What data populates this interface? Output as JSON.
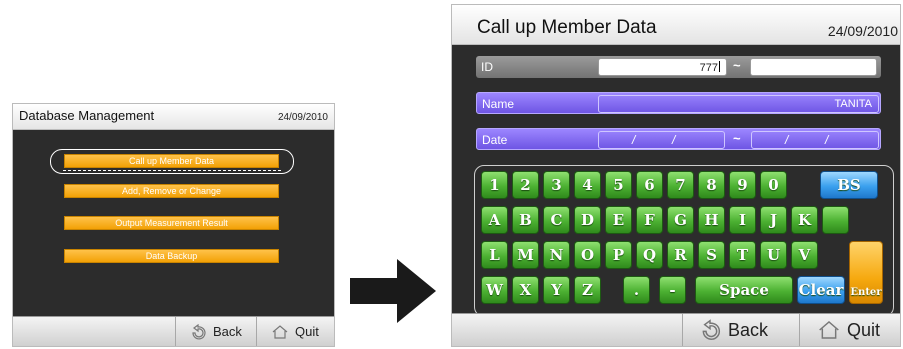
{
  "left_screen": {
    "title": "Database Management",
    "date": "24/09/2010",
    "menu": [
      {
        "label": "Call up Member Data"
      },
      {
        "label": "Add, Remove or Change"
      },
      {
        "label": "Output Measurement Result"
      },
      {
        "label": "Data Backup"
      }
    ],
    "bottom": {
      "back_label": "Back",
      "quit_label": "Quit"
    }
  },
  "right_screen": {
    "title": "Call up Member Data",
    "date": "24/09/2010",
    "fields": {
      "id": {
        "label": "ID",
        "from": "777",
        "range_sep": "~",
        "to": ""
      },
      "name": {
        "label": "Name",
        "value": "TANITA"
      },
      "date": {
        "label": "Date",
        "sep": "/",
        "range_sep": "~"
      }
    },
    "keyboard": {
      "rows": [
        [
          "1",
          "2",
          "3",
          "4",
          "5",
          "6",
          "7",
          "8",
          "9",
          "0",
          "BS"
        ],
        [
          "A",
          "B",
          "C",
          "D",
          "E",
          "F",
          "G",
          "H",
          "I",
          "J",
          "K",
          ""
        ],
        [
          "L",
          "M",
          "N",
          "O",
          "P",
          "Q",
          "R",
          "S",
          "T",
          "U",
          "V"
        ],
        [
          "W",
          "X",
          "Y",
          "Z",
          ".",
          "-",
          "Space",
          "Clear",
          "Enter"
        ]
      ]
    },
    "bottom": {
      "back_label": "Back",
      "quit_label": "Quit"
    }
  },
  "colors": {
    "menu_button": "#f3a106",
    "field_purple": "#7d66f0",
    "key_green": "#4cb132",
    "key_blue": "#3aa0ee",
    "key_orange": "#f6a90f",
    "screen_bg": "#2c2c2c"
  },
  "icons": [
    "back-arrow-icon",
    "home-icon",
    "right-arrow-icon"
  ]
}
